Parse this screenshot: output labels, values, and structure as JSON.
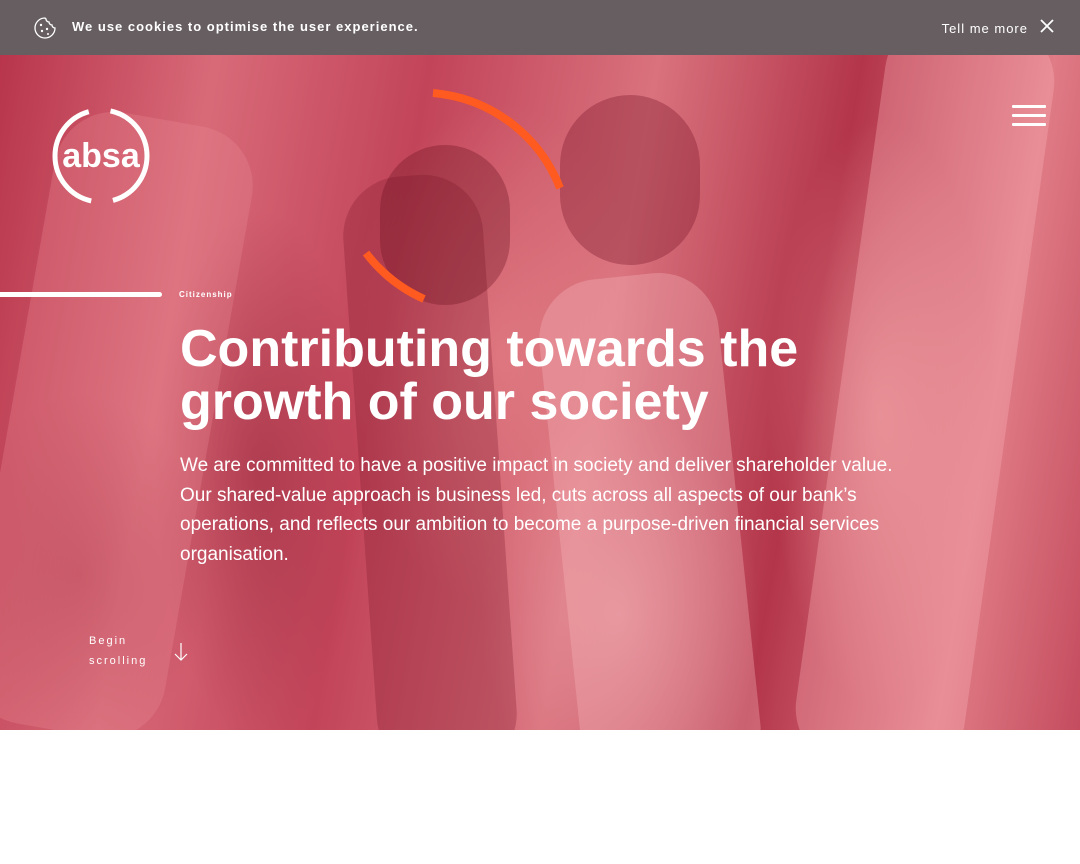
{
  "cookie_banner": {
    "message": "We use cookies to optimise the user experience.",
    "tell_more": "Tell me more",
    "background": "#675e62"
  },
  "logo": {
    "text": "absa",
    "color": "#ffffff"
  },
  "hero": {
    "category": "Citizenship",
    "title": "Contributing towards the growth of our society",
    "description": "We are committed to have a positive impact in society and deliver shareholder value. Our shared-value approach is business led, cuts across all aspects of our bank’s operations, and reflects our ambition to become a purpose-driven financial services organisation.",
    "scroll_label": "Begin scrolling",
    "accent": "#ff5a1f",
    "overlay": "#c8384f"
  },
  "icons": {
    "cookie": "cookie-icon",
    "close": "close-icon",
    "menu": "hamburger-menu-icon",
    "arrow": "arrow-down-icon"
  }
}
